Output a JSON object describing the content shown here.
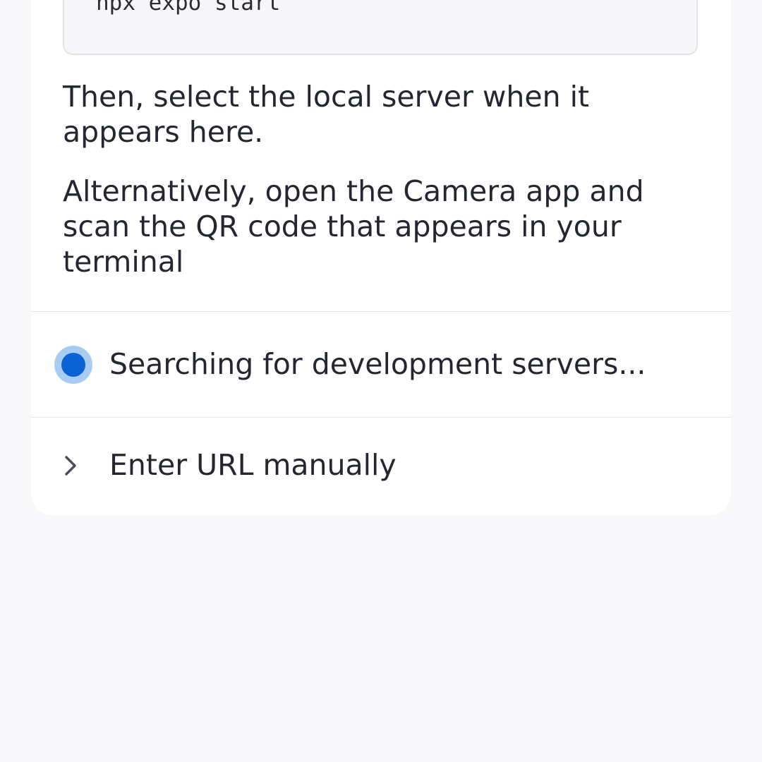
{
  "code": {
    "command": "npx expo start"
  },
  "instructions": {
    "select_server": "Then, select the local server when it appears here.",
    "alternative": "Alternatively, open the Camera app and scan the QR code that appears in your terminal"
  },
  "status": {
    "searching_label": "Searching for development servers...",
    "indicator_color": "#0b63d3"
  },
  "manual": {
    "label": "Enter URL manually",
    "icon": "chevron-right-icon"
  }
}
